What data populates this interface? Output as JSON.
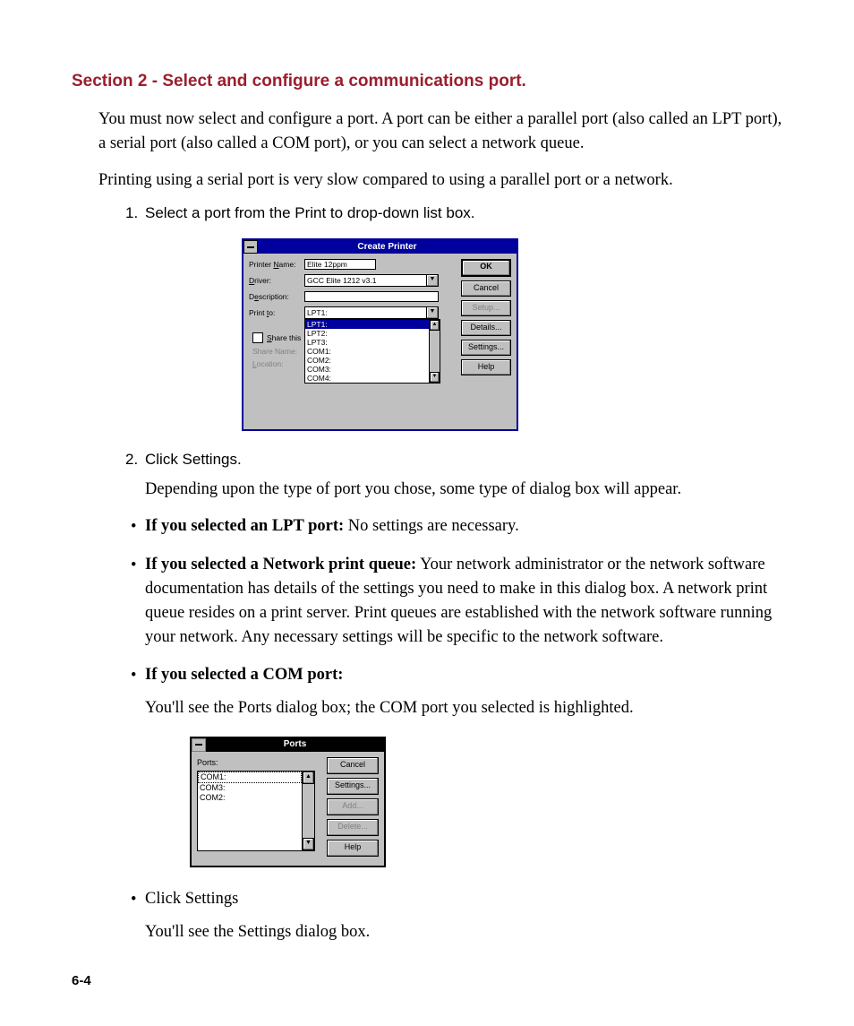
{
  "heading": "Section 2 - Select and configure a communications port.",
  "para1": "You must now select and configure a port. A port can be either a parallel port (also called an LPT port), a serial port (also called a COM port), or you can select a network queue.",
  "para2": "Printing using a serial port is very slow compared to using a parallel port or a network.",
  "step1_num": "1.",
  "step1": "Select a port from the Print to drop-down list box.",
  "step2_num": "2.",
  "step2": "Click Settings.",
  "step2_body": "Depending upon the type of port you chose, some type of dialog box will appear.",
  "bullet1_bold": "If you selected an LPT port:",
  "bullet1_rest": " No settings are necessary.",
  "bullet2_bold": "If you selected a Network print queue:",
  "bullet2_rest": " Your network administrator or the network software documentation has details of the settings you need to make in this dialog box. A network print queue resides on a print server. Print queues are established with the network software running your network. Any necessary settings will be specific to the network software.",
  "bullet3_bold": "If you selected a COM port:",
  "bullet3_body": "You'll see the Ports dialog box; the COM port you selected is highlighted.",
  "bullet4": "Click Settings",
  "bullet4_body": "You'll see the Settings dialog box.",
  "page_num": "6-4",
  "dlg1": {
    "title": "Create Printer",
    "labels": {
      "printer_name_pre": "Printer ",
      "printer_name_u": "N",
      "printer_name_post": "ame:",
      "driver_u": "D",
      "driver_post": "river:",
      "description_pre": "D",
      "description_u": "e",
      "description_post": "scription:",
      "print_to_pre": "Print ",
      "print_to_u": "t",
      "print_to_post": "o:",
      "share_u": "S",
      "share_post": "hare this",
      "share_name_pre": "Share ",
      "share_name_post": "Name:",
      "location_u": "L",
      "location_post": "ocation:"
    },
    "values": {
      "printer_name": "Elite 12ppm",
      "driver": "GCC Elite 1212 v3.1",
      "description": "",
      "print_to_selected": "LPT1:"
    },
    "port_options": [
      "LPT1:",
      "LPT2:",
      "LPT3:",
      "COM1:",
      "COM2:",
      "COM3:",
      "COM4:"
    ],
    "buttons": {
      "ok": "OK",
      "cancel": "Cancel",
      "setup": "Setup...",
      "details": "Details...",
      "settings": "Settings...",
      "help": "Help"
    }
  },
  "dlg2": {
    "title": "Ports",
    "ports_label_u": "P",
    "ports_label_post": "orts:",
    "items": [
      "COM1:",
      "COM3:",
      "COM2:"
    ],
    "buttons": {
      "cancel": "Cancel",
      "settings_u": "S",
      "settings_post": "ettings...",
      "add_u": "A",
      "add_post": "dd...",
      "delete_u": "D",
      "delete_post": "elete...",
      "help_u": "H",
      "help_post": "elp"
    }
  }
}
